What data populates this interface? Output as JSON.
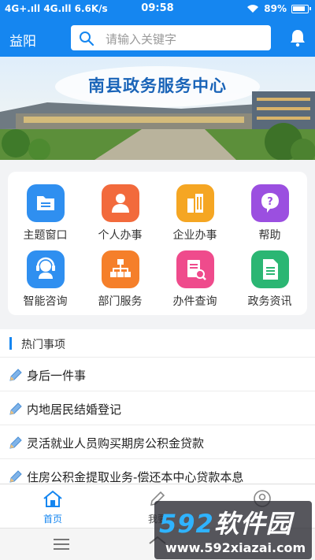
{
  "status": {
    "left": "4G+.ıll 4G.ıll 6.6K/s",
    "time": "09:58",
    "battery": "89%"
  },
  "header": {
    "city": "益阳",
    "search_placeholder": "请输入关键字"
  },
  "banner": {
    "title": "南县政务服务中心"
  },
  "services": [
    {
      "label": "主题窗口",
      "icon": "folder-list-icon",
      "color": "#2f8ff0"
    },
    {
      "label": "个人办事",
      "icon": "person-icon",
      "color": "#f26a3c"
    },
    {
      "label": "企业办事",
      "icon": "building-icon",
      "color": "#f5a623"
    },
    {
      "label": "帮助",
      "icon": "help-icon",
      "color": "#9b4fe0"
    },
    {
      "label": "智能咨询",
      "icon": "headset-icon",
      "color": "#2f8ff0"
    },
    {
      "label": "部门服务",
      "icon": "org-chart-icon",
      "color": "#f57f2a"
    },
    {
      "label": "办件查询",
      "icon": "document-search-icon",
      "color": "#ef4b8c"
    },
    {
      "label": "政务资讯",
      "icon": "document-icon",
      "color": "#2bb673"
    }
  ],
  "hot": {
    "title": "热门事项",
    "items": [
      "身后一件事",
      "内地居民结婚登记",
      "灵活就业人员购买期房公积金贷款",
      "住房公积金提取业务-偿还本中心贷款本息"
    ]
  },
  "tabs": [
    {
      "label": "首页",
      "icon": "home-icon",
      "active": true
    },
    {
      "label": "我要",
      "icon": "pen-icon",
      "active": false
    },
    {
      "label": "",
      "icon": "user-icon",
      "active": false
    }
  ],
  "watermark": {
    "brand_num": "592",
    "brand_text": "软件园",
    "url": "www.592xiazai.com"
  },
  "colors": {
    "primary": "#1586f0"
  }
}
